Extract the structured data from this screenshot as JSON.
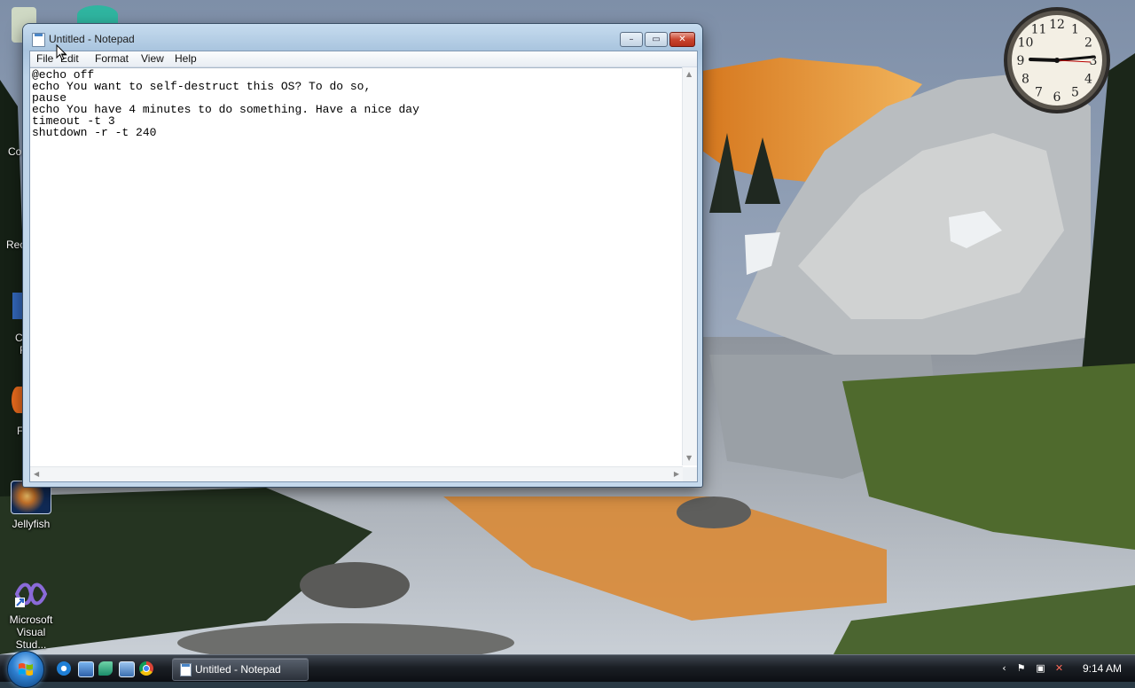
{
  "window": {
    "title": "Untitled - Notepad",
    "menu": [
      "File",
      "Edit",
      "Format",
      "View",
      "Help"
    ],
    "content_lines": [
      "@echo off",
      "echo You want to self-destruct this OS? To do so,",
      "pause",
      "echo You have 4 minutes to do something. Have a nice day",
      "timeout -t 3",
      "shutdown -r -t 240"
    ],
    "buttons": {
      "minimize": "–",
      "maximize": "▭",
      "close": "✕"
    }
  },
  "desktop_icons": [
    {
      "label": "Jellyfish",
      "icon": "image-file-icon"
    },
    {
      "label": "Microsoft Visual Stud...",
      "icon": "visual-studio-icon"
    }
  ],
  "desktop_partial_labels": [
    "Co",
    "Rec",
    "C",
    "F",
    "F"
  ],
  "clock": {
    "hour_numerals": [
      "12",
      "1",
      "2",
      "3",
      "4",
      "5",
      "6",
      "7",
      "8",
      "9",
      "10",
      "11"
    ]
  },
  "taskbar": {
    "quick_launch": [
      "internet-explorer-icon",
      "show-desktop-icon",
      "media-player-icon",
      "switch-windows-icon",
      "chrome-icon"
    ],
    "task_button_label": "Untitled - Notepad",
    "tray_icons": [
      "chevron-left-icon",
      "flag-icon",
      "network-icon",
      "volume-muted-icon"
    ],
    "time": "9:14 AM"
  }
}
